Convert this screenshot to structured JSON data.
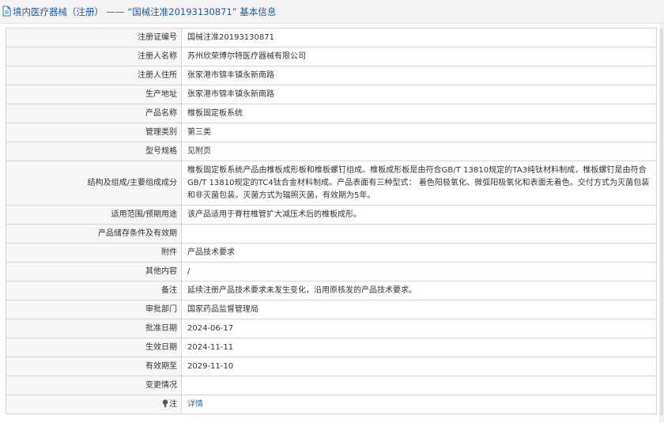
{
  "header": {
    "section": "境内医疗器械（注册）",
    "separator": " —— ",
    "registration_title": "“国械注准20193130871”",
    "suffix": " 基本信息"
  },
  "rows": [
    {
      "label": "注册证编号",
      "value": "国械注准20193130871"
    },
    {
      "label": "注册人名称",
      "value": "苏州欣荣博尔特医疗器械有限公司"
    },
    {
      "label": "注册人住所",
      "value": "张家港市锦丰镇永新南路"
    },
    {
      "label": "生产地址",
      "value": "张家港市锦丰镇永新南路"
    },
    {
      "label": "产品名称",
      "value": "椎板固定板系统"
    },
    {
      "label": "管理类别",
      "value": "第三类"
    },
    {
      "label": "型号规格",
      "value": "见附页"
    },
    {
      "label": "结构及组成/主要组成成分",
      "value": "椎板固定板系统产品由椎板成形板和椎板螺钉组成。椎板成形板是由符合GB/T 13810规定的TA3纯钛材料制成，椎板螺钉是由符合GB/T 13810规定的TC4钛合金材料制成。产品表面有三种型式： 着色阳极氧化、微弧阳极氧化和表面无着色。交付方式为灭菌包装和非灭菌包装。灭菌方式为辐照灭菌，有效期为5年。"
    },
    {
      "label": "适用范围/预期用途",
      "value": "该产品适用于脊柱椎管扩大减压术后的椎板成形。"
    },
    {
      "label": "产品储存条件及有效期",
      "value": ""
    },
    {
      "label": "附件",
      "value": "产品技术要求"
    },
    {
      "label": "其他内容",
      "value": "/"
    },
    {
      "label": "备注",
      "value": "延续注册产品技术要求未发生变化，沿用原核发的产品技术要求。"
    },
    {
      "label": "审批部门",
      "value": "国家药品监督管理局"
    },
    {
      "label": "批准日期",
      "value": "2024-06-17"
    },
    {
      "label": "生效日期",
      "value": "2024-11-11"
    },
    {
      "label": "有效期至",
      "value": "2029-11-10"
    },
    {
      "label": "变更情况",
      "value": ""
    }
  ],
  "note": {
    "label": "注",
    "link_text": "详情",
    "icon": "lightbulb-icon"
  }
}
